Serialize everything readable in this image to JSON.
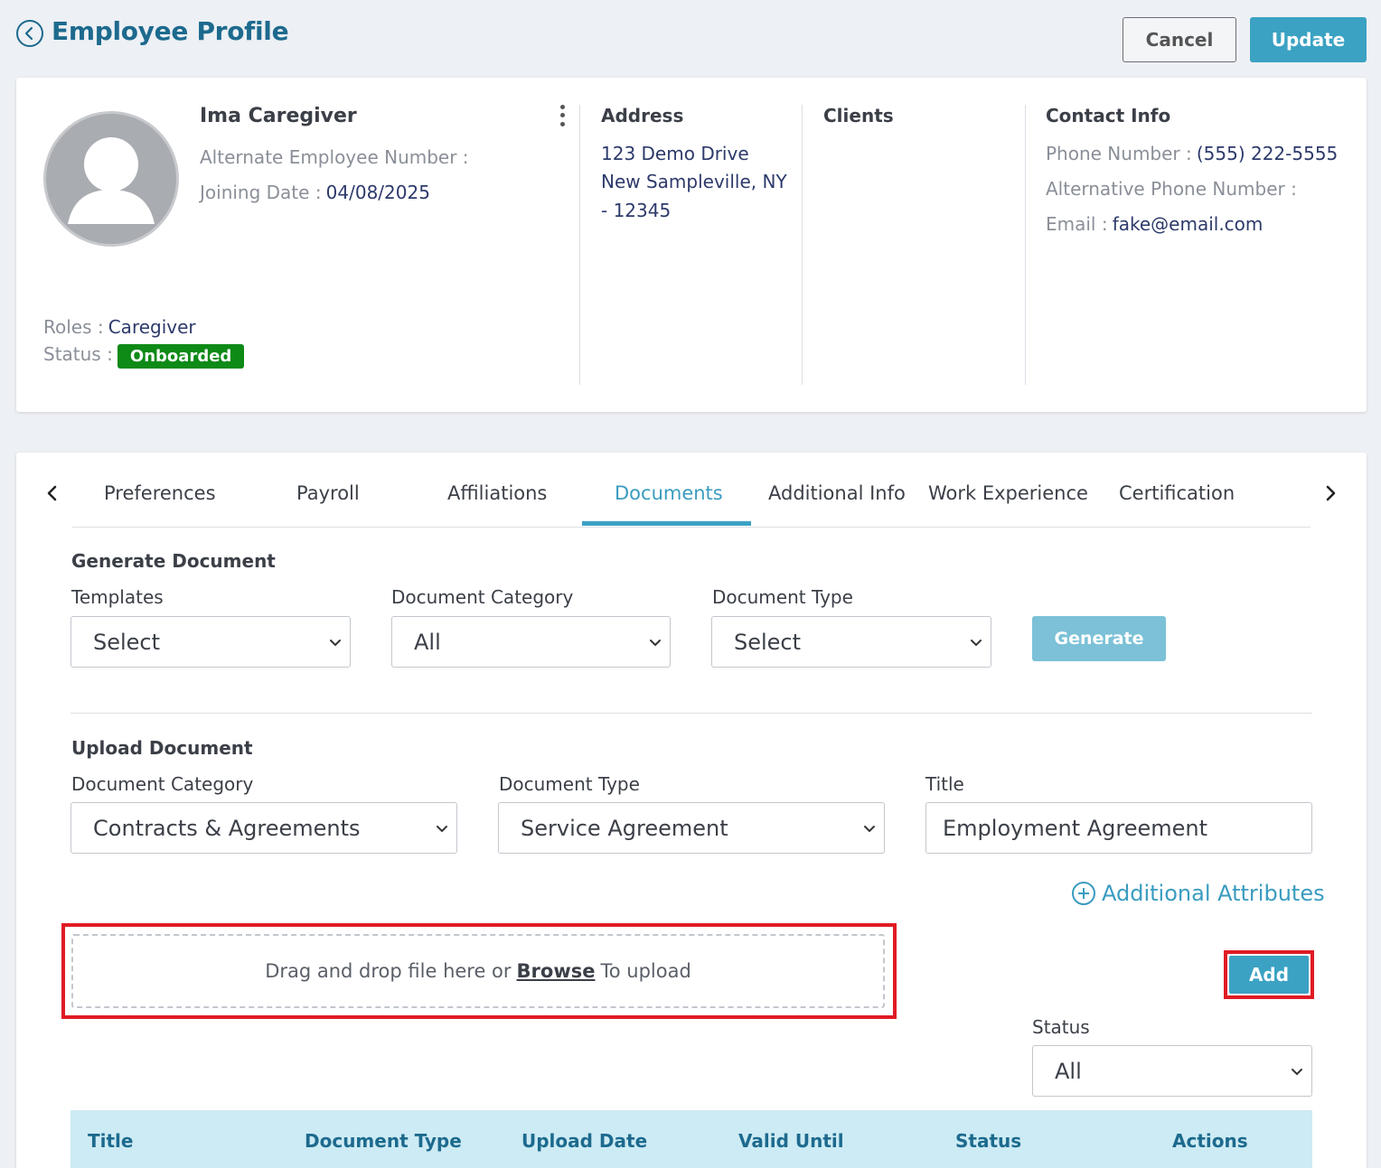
{
  "header": {
    "title": "Employee Profile",
    "cancel_label": "Cancel",
    "update_label": "Update"
  },
  "profile": {
    "name": "Ima Caregiver",
    "alt_emp_label": "Alternate Employee Number :",
    "joining_label": "Joining Date :",
    "joining_value": "04/08/2025",
    "roles_label": "Roles :",
    "roles_value": "Caregiver",
    "status_label": "Status :",
    "status_value": "Onboarded",
    "status_color": "#0e8a17"
  },
  "address": {
    "heading": "Address",
    "line1": "123 Demo Drive",
    "line2": "New Sampleville, NY",
    "line3": "- 12345"
  },
  "clients": {
    "heading": "Clients"
  },
  "contact": {
    "heading": "Contact Info",
    "phone_label": "Phone Number :",
    "phone_value": "(555) 222-5555",
    "alt_phone_label": "Alternative Phone Number :",
    "email_label": "Email :",
    "email_value": "fake@email.com"
  },
  "tabs": [
    {
      "label": "Preferences"
    },
    {
      "label": "Payroll"
    },
    {
      "label": "Affiliations"
    },
    {
      "label": "Documents",
      "active": true
    },
    {
      "label": "Additional Info"
    },
    {
      "label": "Work Experience"
    },
    {
      "label": "Certification"
    }
  ],
  "generate": {
    "title": "Generate Document",
    "templates_label": "Templates",
    "templates_value": "Select",
    "category_label": "Document Category",
    "category_value": "All",
    "type_label": "Document Type",
    "type_value": "Select",
    "button_label": "Generate"
  },
  "upload": {
    "title": "Upload Document",
    "category_label": "Document Category",
    "category_value": "Contracts & Agreements",
    "type_label": "Document Type",
    "type_value": "Service Agreement",
    "title_label": "Title",
    "title_value": "Employment Agreement",
    "additional_attributes": "Additional Attributes",
    "drop_prefix": "Drag and drop file here or",
    "drop_browse": "Browse",
    "drop_suffix": "To upload",
    "add_label": "Add",
    "status_label": "Status",
    "status_value": "All"
  },
  "table": {
    "columns": [
      "Title",
      "Document Type",
      "Upload Date",
      "Valid Until",
      "Status",
      "Actions"
    ]
  },
  "colors": {
    "accent": "#3ba2c3",
    "title_blue": "#1d6a8e",
    "highlight_red": "#e01b24",
    "table_header_bg": "#cdebf4"
  },
  "icons": {
    "back": "chevron-left-circle-icon",
    "menu": "kebab-menu-icon",
    "avatar": "user-silhouette-icon",
    "tab_prev": "chevron-left-icon",
    "tab_next": "chevron-right-icon",
    "select_chevron": "chevron-down-icon",
    "add_attr": "plus-circle-icon"
  }
}
